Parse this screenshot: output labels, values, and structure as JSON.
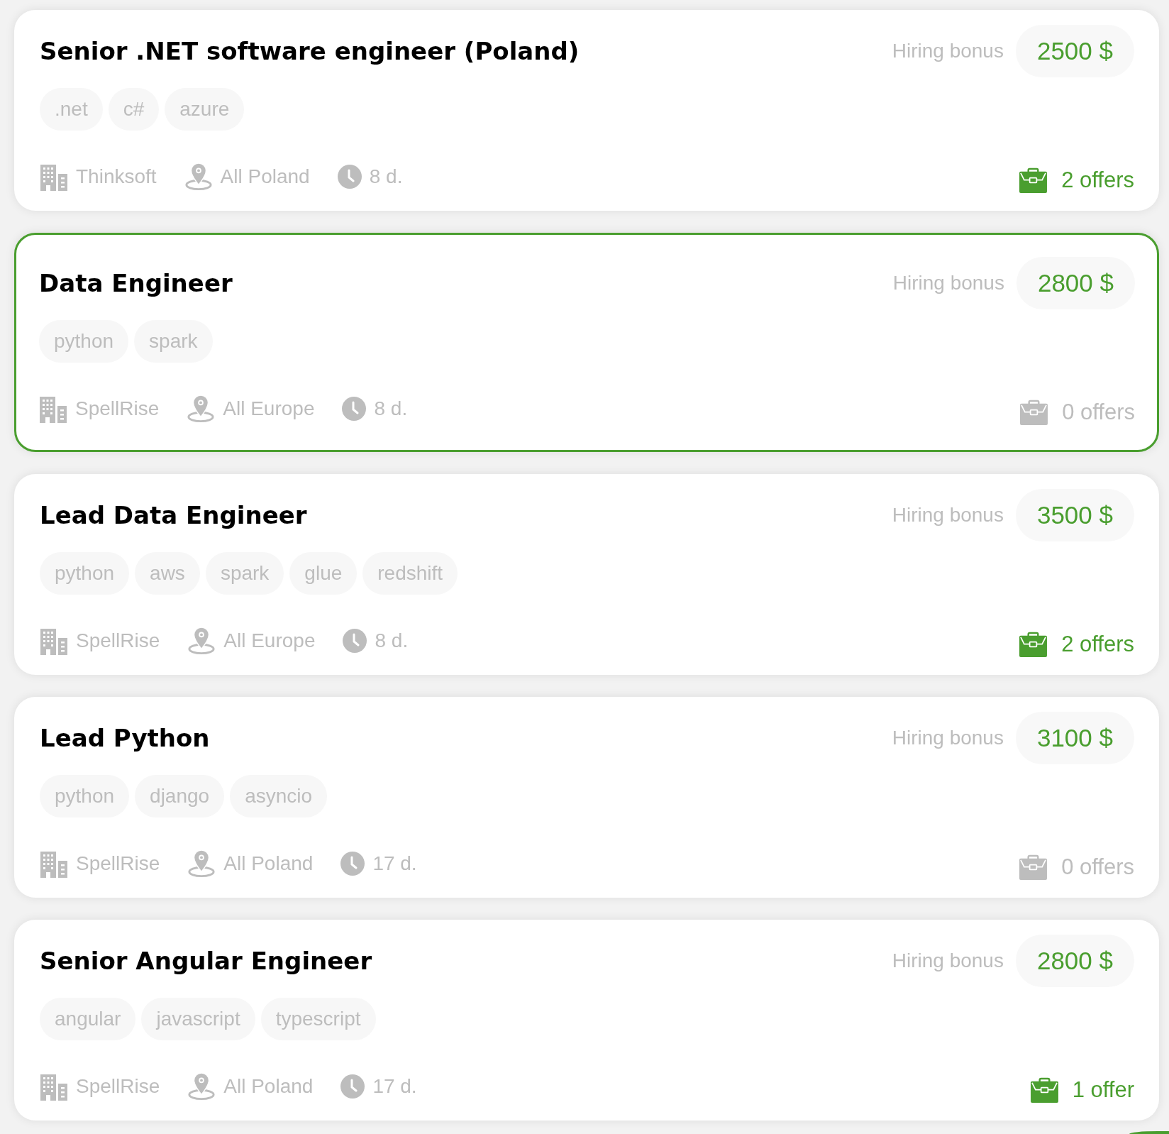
{
  "jobs": [
    {
      "title": "Senior .NET software engineer (Poland)",
      "selected": false,
      "bonus_label": "Hiring bonus",
      "bonus": "2500 $",
      "tags": [
        ".net",
        "c#",
        "azure"
      ],
      "company": "Thinksoft",
      "location": "All Poland",
      "age": "8 d.",
      "offers": {
        "text": "2 offers",
        "active": true
      }
    },
    {
      "title": "Data Engineer",
      "selected": true,
      "bonus_label": "Hiring bonus",
      "bonus": "2800 $",
      "tags": [
        "python",
        "spark"
      ],
      "company": "SpellRise",
      "location": "All Europe",
      "age": "8 d.",
      "offers": {
        "text": "0 offers",
        "active": false
      }
    },
    {
      "title": "Lead Data Engineer",
      "selected": false,
      "bonus_label": "Hiring bonus",
      "bonus": "3500 $",
      "tags": [
        "python",
        "aws",
        "spark",
        "glue",
        "redshift"
      ],
      "company": "SpellRise",
      "location": "All Europe",
      "age": "8 d.",
      "offers": {
        "text": "2 offers",
        "active": true
      }
    },
    {
      "title": "Lead Python",
      "selected": false,
      "bonus_label": "Hiring bonus",
      "bonus": "3100 $",
      "tags": [
        "python",
        "django",
        "asyncio"
      ],
      "company": "SpellRise",
      "location": "All Poland",
      "age": "17 d.",
      "offers": {
        "text": "0 offers",
        "active": false
      }
    },
    {
      "title": "Senior Angular Engineer",
      "selected": false,
      "bonus_label": "Hiring bonus",
      "bonus": "2800 $",
      "tags": [
        "angular",
        "javascript",
        "typescript"
      ],
      "company": "SpellRise",
      "location": "All Poland",
      "age": "17 d.",
      "offers": {
        "text": "1 offer",
        "active": true
      }
    }
  ]
}
